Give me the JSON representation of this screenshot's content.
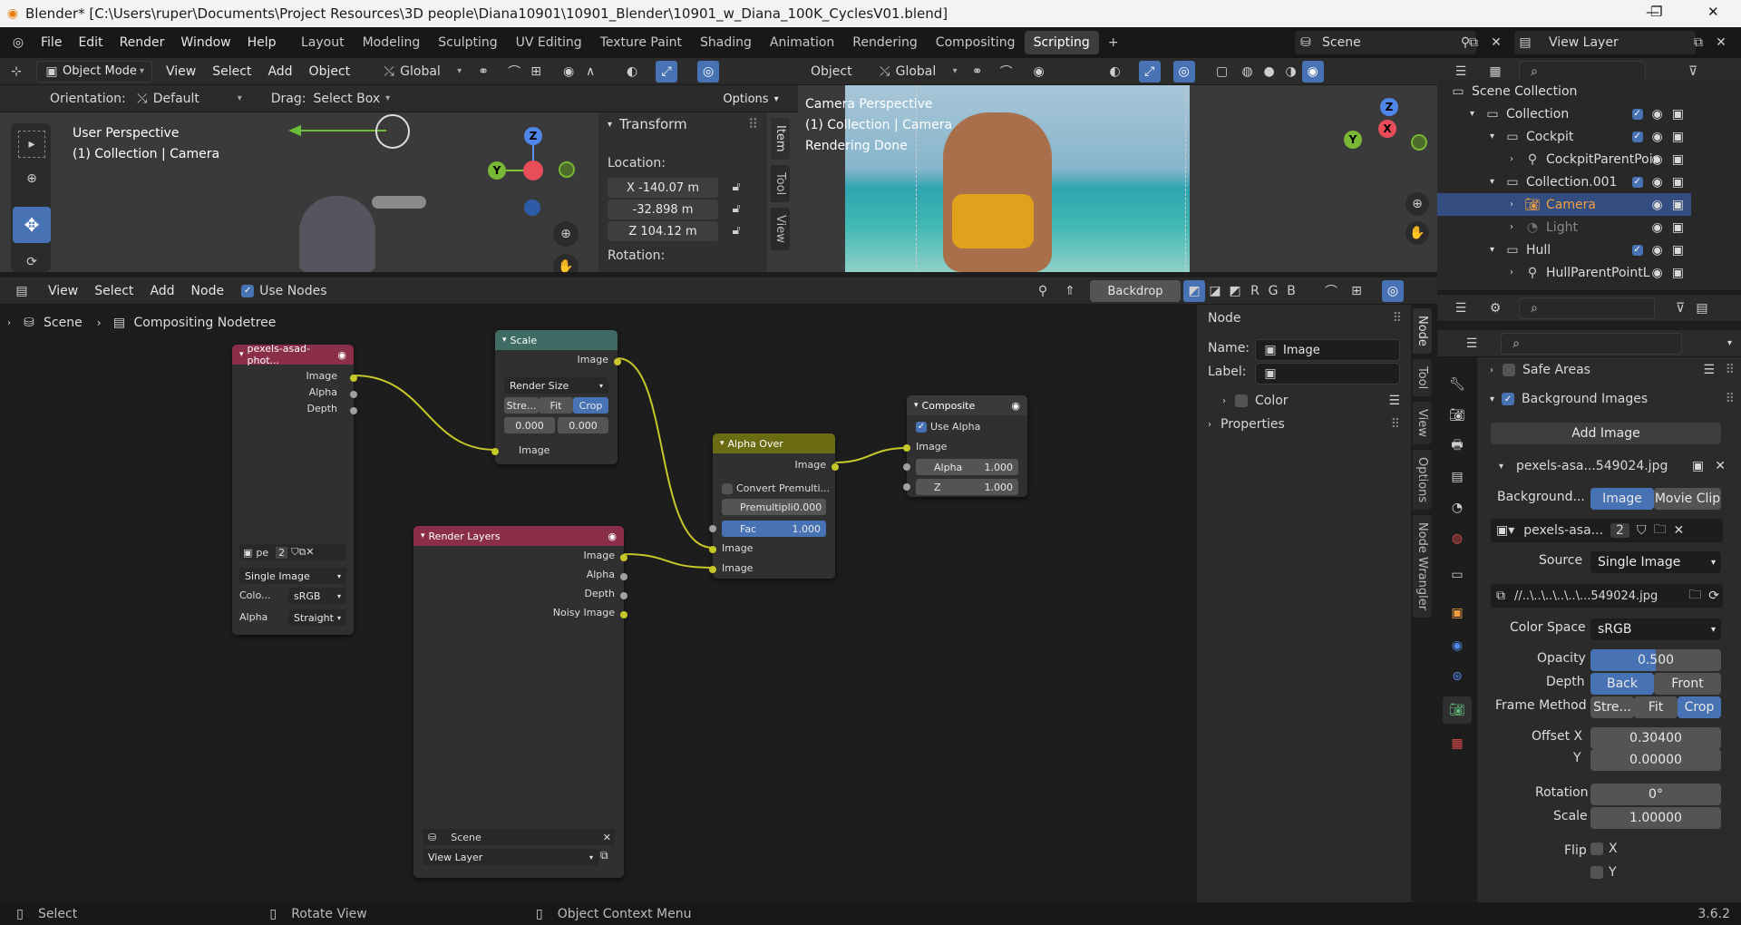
{
  "window": {
    "title": "Blender* [C:\\Users\\ruper\\Documents\\Project Resources\\3D people\\Diana10901\\10901_Blender\\10901_w_Diana_100K_CyclesV01.blend]",
    "minimize": "—",
    "maximize": "❐",
    "close": "✕"
  },
  "menu": [
    "File",
    "Edit",
    "Render",
    "Window",
    "Help"
  ],
  "workspaces": [
    {
      "label": "Layout"
    },
    {
      "label": "Modeling"
    },
    {
      "label": "Sculpting"
    },
    {
      "label": "UV Editing"
    },
    {
      "label": "Texture Paint"
    },
    {
      "label": "Shading"
    },
    {
      "label": "Animation"
    },
    {
      "label": "Rendering"
    },
    {
      "label": "Compositing"
    },
    {
      "label": "Scripting",
      "active": true
    },
    {
      "label": "+"
    }
  ],
  "scene": {
    "name": "Scene",
    "view_layer": "View Layer"
  },
  "viewport": {
    "mode": "Object Mode",
    "menus": [
      "View",
      "Select",
      "Add",
      "Object"
    ],
    "orientation_global": "Global",
    "orientation_label": "Orientation:",
    "orientation_value": "Default",
    "drag_label": "Drag:",
    "drag_value": "Select Box",
    "options": "Options",
    "title": "User Perspective",
    "subtitle": "(1) Collection | Camera"
  },
  "transform": {
    "header": "Transform",
    "location_label": "Location:",
    "x": "X -140.07 m",
    "y": "-32.898 m",
    "z": "Z 104.12 m",
    "rotation_label": "Rotation:"
  },
  "sidebar_tabs": [
    "Item",
    "Tool",
    "View"
  ],
  "camera_view": {
    "object_menu": "Object",
    "orientation": "Global",
    "title": "Camera Perspective",
    "subtitle": "(1) Collection | Camera",
    "status": "Rendering Done"
  },
  "gizmo": {
    "x": "X",
    "y": "Y",
    "z": "Z"
  },
  "outliner": {
    "rows": [
      {
        "label": "Scene Collection",
        "indent": 0
      },
      {
        "label": "Collection",
        "indent": 1
      },
      {
        "label": "Cockpit",
        "indent": 2
      },
      {
        "label": "CockpitParentPoir",
        "indent": 3
      },
      {
        "label": "Collection.001",
        "indent": 2
      },
      {
        "label": "Camera",
        "indent": 3,
        "selected": true
      },
      {
        "label": "Light",
        "indent": 3,
        "dim": true
      },
      {
        "label": "Hull",
        "indent": 2
      },
      {
        "label": "HullParentPointL",
        "indent": 3
      }
    ]
  },
  "node_editor": {
    "menus": [
      "View",
      "Select",
      "Add",
      "Node"
    ],
    "use_nodes": "Use Nodes",
    "backdrop": "Backdrop",
    "channels": [
      "R",
      "G",
      "B"
    ],
    "breadcrumb_scene": "Scene",
    "breadcrumb_tree": "Compositing Nodetree"
  },
  "nodes": {
    "image": {
      "title": "pexels-asad-phot...",
      "outputs": [
        "Image",
        "Alpha",
        "Depth"
      ],
      "img_short": "pe",
      "users": "2",
      "source": "Single Image",
      "colorspace_label": "Colo...",
      "colorspace": "sRGB",
      "alpha_label": "Alpha",
      "alpha": "Straight"
    },
    "scale": {
      "title": "Scale",
      "output": "Image",
      "mode": "Render Size",
      "tabs": [
        "Stre...",
        "Fit",
        "Crop"
      ],
      "x": "0.000",
      "y": "0.000",
      "input": "Image"
    },
    "render_layers": {
      "title": "Render Layers",
      "outputs": [
        "Image",
        "Alpha",
        "Depth",
        "Noisy Image"
      ],
      "scene": "Scene",
      "view_layer": "View Layer"
    },
    "alpha_over": {
      "title": "Alpha Over",
      "output": "Image",
      "convert": "Convert Premulti...",
      "premul_label": "Premultipli",
      "premul": "0.000",
      "fac_label": "Fac",
      "fac": "1.000",
      "inputs": [
        "Image",
        "Image"
      ]
    },
    "composite": {
      "title": "Composite",
      "use_alpha": "Use Alpha",
      "input": "Image",
      "alpha_label": "Alpha",
      "alpha": "1.000",
      "z_label": "Z",
      "z": "1.000"
    }
  },
  "node_sidebar": {
    "header": "Node",
    "name_label": "Name:",
    "name": "Image",
    "label_label": "Label:",
    "label": "",
    "color": "Color",
    "properties": "Properties",
    "tabs": [
      "Node",
      "Tool",
      "View",
      "Options",
      "Node Wrangler"
    ]
  },
  "properties": {
    "safe_areas": "Safe Areas",
    "background_images": "Background Images",
    "add_image": "Add Image",
    "image_file": "pexels-asa...549024.jpg",
    "background_label": "Background...",
    "bg_tabs": [
      "Image",
      "Movie Clip"
    ],
    "img_name": "pexels-asa...",
    "img_users": "2",
    "source_label": "Source",
    "source": "Single Image",
    "filepath": "//..\\..\\..\\..\\..\\...549024.jpg",
    "colorspace_label": "Color Space",
    "colorspace": "sRGB",
    "opacity_label": "Opacity",
    "opacity": "0.500",
    "opacity_value": 0.5,
    "depth_label": "Depth",
    "depth_back": "Back",
    "depth_front": "Front",
    "frame_method_label": "Frame Method",
    "frame_tabs": [
      "Stre...",
      "Fit",
      "Crop"
    ],
    "offset_x_label": "Offset X",
    "offset_x": "0.30400",
    "offset_y_label": "Y",
    "offset_y": "0.00000",
    "rotation_label": "Rotation",
    "rotation": "0°",
    "scale_label": "Scale",
    "scale": "1.00000",
    "flip_label": "Flip",
    "flip_x": "X",
    "flip_y": "Y"
  },
  "status": {
    "select": "Select",
    "rotate": "Rotate View",
    "context": "Object Context Menu",
    "version": "3.6.2"
  }
}
